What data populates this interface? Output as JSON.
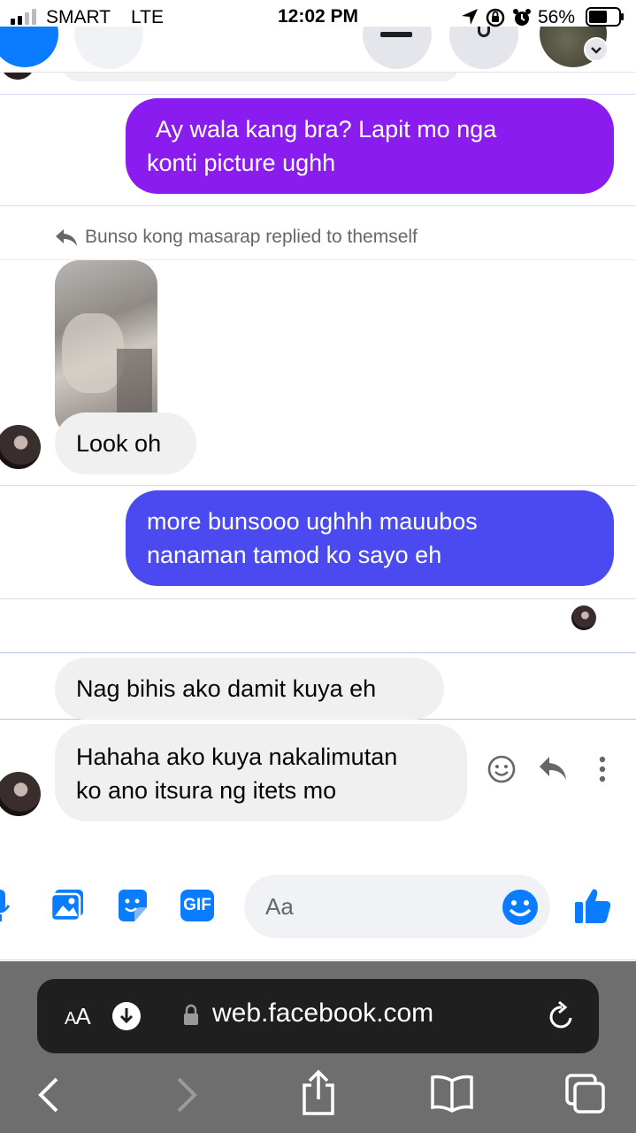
{
  "status_bar": {
    "carrier": "SMART",
    "network": "LTE",
    "time": "12:02 PM",
    "battery_percent": "56%"
  },
  "messages": [
    {
      "direction": "outgoing",
      "text_lines": [
        "Ay wala kang bra? Lapit mo nga",
        "konti picture ughh"
      ],
      "color": "#8b1cf0"
    },
    {
      "direction": "incoming",
      "reply_label": "Bunso kong masarap replied to themself",
      "has_photo": true,
      "text": "Look oh"
    },
    {
      "direction": "outgoing",
      "text_lines": [
        "more bunsooo ughhh mauubos",
        "nanaman tamod ko sayo eh"
      ],
      "color": "#4a4af0"
    },
    {
      "direction": "incoming",
      "text": "Nag bihis ako damit kuya eh"
    },
    {
      "direction": "incoming",
      "text_lines": [
        "Hahaha ako kuya nakalimutan",
        "ko ano itsura ng itets mo"
      ]
    }
  ],
  "message_actions": [
    "react-icon",
    "reply-icon",
    "more-icon"
  ],
  "composer": {
    "placeholder": "Aa",
    "icons": [
      "microphone-icon",
      "photo-icon",
      "sticker-icon",
      "gif-icon",
      "emoji-icon",
      "thumbs-up-icon"
    ],
    "gif_label": "GIF"
  },
  "safari": {
    "aa_label_small": "A",
    "aa_label_large": "A",
    "url": "web.facebook.com"
  },
  "colors": {
    "messenger_blue": "#0a7cff",
    "incoming_bubble": "#f0f0f0",
    "safari_bar": "#6e6e6e"
  }
}
